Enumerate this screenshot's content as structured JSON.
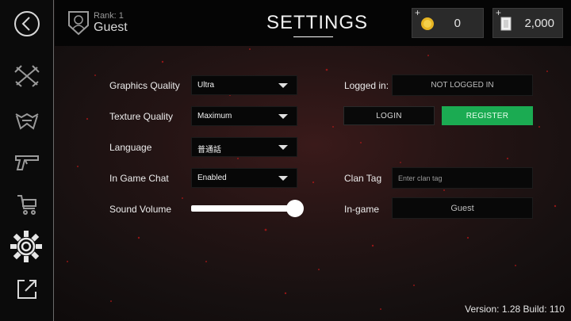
{
  "header": {
    "rank_label": "Rank: 1",
    "player_name": "Guest",
    "title": "SETTINGS",
    "currencies": [
      {
        "icon": "gold-coin-icon",
        "plus": "+",
        "amount": "0"
      },
      {
        "icon": "card-icon",
        "plus": "+",
        "amount": "2,000"
      }
    ]
  },
  "sidebar": {
    "items": [
      {
        "name": "back-icon"
      },
      {
        "name": "crossed-weapons-icon"
      },
      {
        "name": "armor-icon"
      },
      {
        "name": "pistol-icon"
      },
      {
        "name": "shopping-cart-icon"
      },
      {
        "name": "gear-icon",
        "active": true
      },
      {
        "name": "external-link-icon"
      }
    ]
  },
  "settings": {
    "graphics_quality": {
      "label": "Graphics Quality",
      "value": "Ultra"
    },
    "texture_quality": {
      "label": "Texture Quality",
      "value": "Maximum"
    },
    "language": {
      "label": "Language",
      "value": "普通話"
    },
    "in_game_chat": {
      "label": "In Game Chat",
      "value": "Enabled"
    },
    "sound_volume": {
      "label": "Sound Volume",
      "level": 1.0
    }
  },
  "account": {
    "logged_in_label": "Logged in:",
    "logged_in_value": "NOT LOGGED IN",
    "login_button": "LOGIN",
    "register_button": "REGISTER",
    "clan_tag_label": "Clan Tag",
    "clan_tag_placeholder": "Enter clan tag",
    "ingame_label": "In-game",
    "ingame_value": "Guest"
  },
  "footer": {
    "version": "Version: 1.28 Build: 110"
  },
  "colors": {
    "register_green": "#1bab52",
    "background_red": "#3a1a1a"
  }
}
